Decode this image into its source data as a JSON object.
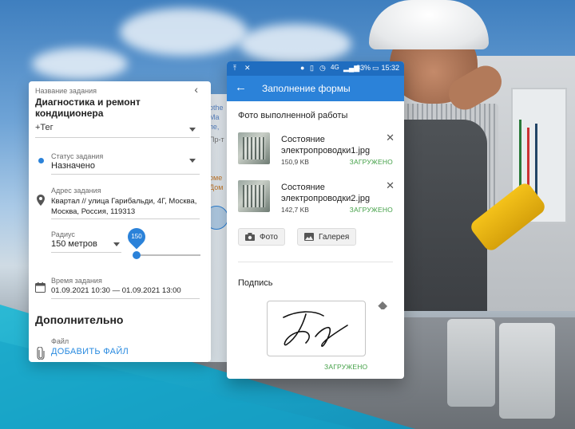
{
  "left_card": {
    "task_name_label": "Название задания",
    "task_name": "Диагностика и ремонт кондиционера",
    "tag_placeholder": "+Тег",
    "status_label": "Статус задания",
    "status_value": "Назначено",
    "address_label": "Адрес задания",
    "address_value": "Квартал // улица Гарибальди, 4Г, Москва, Москва, Россия, 119313",
    "radius_label": "Радиус",
    "radius_value": "150 метров",
    "radius_pin": "150",
    "time_label": "Время задания",
    "time_value": "01.09.2021 10:30 — 01.09.2021 13:00",
    "section_title": "Дополнительно",
    "file_label": "Файл",
    "add_file": "ДОБАВИТЬ ФАЙЛ",
    "map_peek_lines": [
      "othe",
      "Ma",
      "пе,",
      "Пр-т",
      "оме",
      "Дом"
    ]
  },
  "phone": {
    "status_bar": {
      "battery": "83%",
      "time": "15:32",
      "network": "4G"
    },
    "title": "Заполнение формы",
    "photo_section": "Фото выполненной работы",
    "files": [
      {
        "name_line1": "Состояние",
        "name_line2": "электропроводки1.jpg",
        "size": "150,9 KB",
        "status": "ЗАГРУЖЕНО"
      },
      {
        "name_line1": "Состояние",
        "name_line2": "электропроводки2.jpg",
        "size": "142,7 KB",
        "status": "ЗАГРУЖЕНО"
      }
    ],
    "photo_button": "Фото",
    "gallery_button": "Галерея",
    "signature_section": "Подпись",
    "signature_status": "ЗАГРУЖЕНО"
  },
  "colors": {
    "primary": "#2b82d9",
    "primary_dark": "#1f6dc0",
    "success": "#43a047",
    "link": "#2a8be0",
    "teal": "#16a3c6"
  }
}
